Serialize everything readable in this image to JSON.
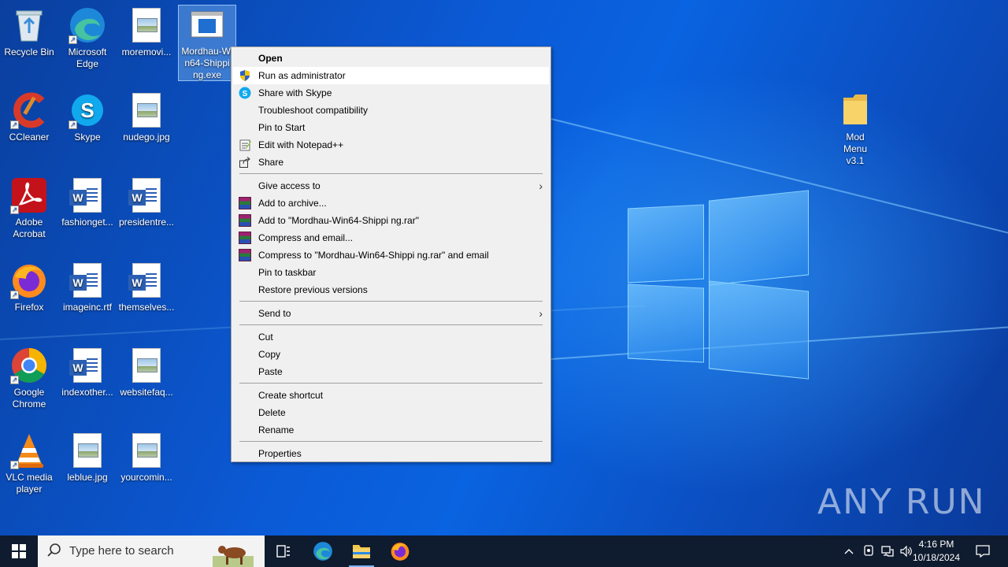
{
  "desktop": {
    "icons": [
      {
        "label": "Recycle Bin",
        "icon": "recycle-bin-icon"
      },
      {
        "label": "Microsoft Edge",
        "icon": "edge-icon"
      },
      {
        "label": "moremovi...",
        "icon": "image-file-icon"
      },
      {
        "label": "Mordhau-Win64-Shipping.exe",
        "icon": "exe-file-icon"
      },
      {
        "label": "CCleaner",
        "icon": "ccleaner-icon"
      },
      {
        "label": "Skype",
        "icon": "skype-icon"
      },
      {
        "label": "nudego.jpg",
        "icon": "image-file-icon"
      },
      {
        "label": "Adobe Acrobat",
        "icon": "acrobat-icon"
      },
      {
        "label": "fashionget...",
        "icon": "word-doc-icon"
      },
      {
        "label": "presidentre...",
        "icon": "word-doc-icon"
      },
      {
        "label": "Firefox",
        "icon": "firefox-icon"
      },
      {
        "label": "imageinc.rtf",
        "icon": "word-doc-icon"
      },
      {
        "label": "themselves...",
        "icon": "word-doc-icon"
      },
      {
        "label": "Google Chrome",
        "icon": "chrome-icon"
      },
      {
        "label": "indexother...",
        "icon": "word-doc-icon"
      },
      {
        "label": "websitefaq...",
        "icon": "image-file-icon"
      },
      {
        "label": "VLC media player",
        "icon": "vlc-icon"
      },
      {
        "label": "leblue.jpg",
        "icon": "image-file-icon"
      },
      {
        "label": "yourcomin...",
        "icon": "image-file-icon"
      },
      {
        "label": "Mod Menu v3.1",
        "icon": "folder-icon"
      }
    ],
    "selected_label_lines": [
      "Mordhau-Wi",
      "n64-Shippi",
      "ng.exe"
    ]
  },
  "context_menu": {
    "items": [
      {
        "label": "Open",
        "bold": true
      },
      {
        "label": "Run as administrator",
        "icon": "uac-shield-icon"
      },
      {
        "label": "Share with Skype",
        "icon": "skype-icon"
      },
      {
        "label": "Troubleshoot compatibility"
      },
      {
        "label": "Pin to Start"
      },
      {
        "label": "Edit with Notepad++",
        "icon": "notepadpp-icon"
      },
      {
        "label": "Share",
        "icon": "share-icon"
      },
      {
        "label": "Give access to",
        "submenu": true
      },
      {
        "label": "Add to archive...",
        "icon": "winrar-icon"
      },
      {
        "label": "Add to \"Mordhau-Win64-Shippi ng.rar\"",
        "icon": "winrar-icon"
      },
      {
        "label": "Compress and email...",
        "icon": "winrar-icon"
      },
      {
        "label": "Compress to \"Mordhau-Win64-Shippi ng.rar\" and email",
        "icon": "winrar-icon"
      },
      {
        "label": "Pin to taskbar"
      },
      {
        "label": "Restore previous versions"
      },
      {
        "label": "Send to",
        "submenu": true
      },
      {
        "label": "Cut"
      },
      {
        "label": "Copy"
      },
      {
        "label": "Paste"
      },
      {
        "label": "Create shortcut"
      },
      {
        "label": "Delete"
      },
      {
        "label": "Rename"
      },
      {
        "label": "Properties"
      }
    ]
  },
  "taskbar": {
    "search_placeholder": "Type here to search",
    "time": "4:16 PM",
    "date": "10/18/2024"
  },
  "watermark": "ANY RUN",
  "colors": {
    "menu_bg": "#f0f0f0",
    "taskbar_bg": "#0f1b2e",
    "selection": "#7ab4f0"
  }
}
